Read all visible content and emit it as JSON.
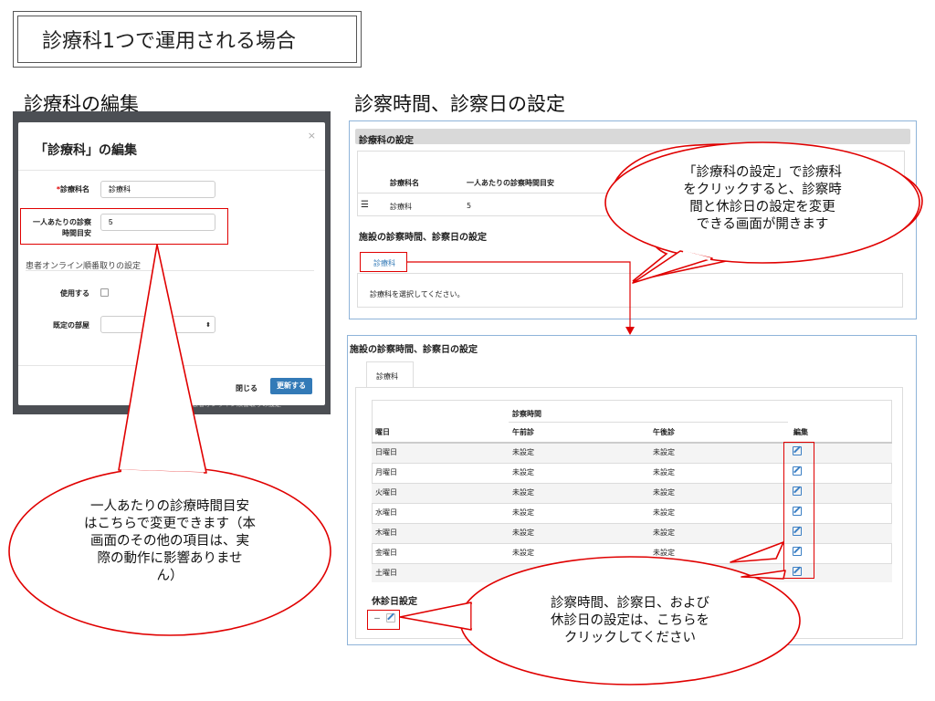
{
  "page": {
    "title": "診療科1つで運用される場合",
    "left_section_title": "診療科の編集",
    "right_section_title": "診察時間、診察日の設定"
  },
  "modal": {
    "title": "「診療科」の編集",
    "close_x": "×",
    "dept_name_required": "*",
    "dept_name_label": "診療科名",
    "dept_name_value": "診療科",
    "consult_time_label_1": "一人あたりの診察",
    "consult_time_label_2": "時間目安",
    "consult_time_value": "5",
    "online_section": "患者オンライン順番取りの設定",
    "use_label": "使用する",
    "room_label": "既定の部屋",
    "close_button": "閉じる",
    "update_button": "更新する",
    "behind_text": "患者オンライン順番取りの設定"
  },
  "panel1": {
    "header": "診療科の設定",
    "col_name": "診療科名",
    "col_time": "一人あたりの診察時間目安",
    "row_name": "診療科",
    "row_time": "5",
    "hours_title": "施設の診察時間、診察日の設定",
    "tab_dept": "診療科",
    "placeholder_msg": "診療科を選択してください。"
  },
  "panel2": {
    "title": "施設の診察時間、診察日の設定",
    "tab_dept": "診療科",
    "group_header": "診察時間",
    "col_day": "曜日",
    "col_am": "午前診",
    "col_pm": "午後診",
    "col_edit": "編集",
    "rows": [
      {
        "day": "日曜日",
        "am": "未設定",
        "pm": "未設定"
      },
      {
        "day": "月曜日",
        "am": "未設定",
        "pm": "未設定"
      },
      {
        "day": "火曜日",
        "am": "未設定",
        "pm": "未設定"
      },
      {
        "day": "水曜日",
        "am": "未設定",
        "pm": "未設定"
      },
      {
        "day": "木曜日",
        "am": "未設定",
        "pm": "未設定"
      },
      {
        "day": "金曜日",
        "am": "未設定",
        "pm": "未設定"
      },
      {
        "day": "土曜日",
        "am": "",
        "pm": ""
      }
    ],
    "holiday_title": "休診日設定",
    "holiday_value": "－"
  },
  "callouts": {
    "top_right": [
      "「診療科の設定」で診療科",
      "をクリックすると、診察時",
      "間と休診日の設定を変更",
      "できる画面が開きます"
    ],
    "left": [
      "一人あたりの診療時間目安",
      "はこちらで変更できます（本",
      "画面のその他の項目は、実",
      "際の動作に影響ありませ",
      "ん）"
    ],
    "bottom": [
      "診察時間、診察日、および",
      "休診日の設定は、こちらを",
      "クリックしてください"
    ]
  },
  "colors": {
    "accent_red": "#e00000",
    "link_blue": "#337ab7",
    "panel_border": "#8fb4d9"
  }
}
